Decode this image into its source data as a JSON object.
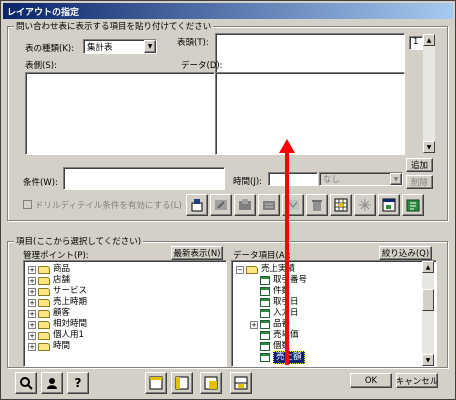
{
  "dialog": {
    "title": "レイアウトの指定"
  },
  "query_group": {
    "label": "問い合わせ表に表示する項目を貼り付けてください",
    "table_type_label": "表の種類(K):",
    "table_type_value": "集計表",
    "header_label": "表頭(T):",
    "side_label": "表側(S):",
    "data_label": "データ(D):",
    "page_number": "1",
    "add_button": "追加",
    "delete_button": "削除",
    "condition_label": "条件(W):",
    "time_label": "時間(J):",
    "time_select_value": "なし",
    "drilldown_checkbox": "ドリルディテイル条件を有効にする(L)"
  },
  "items_group": {
    "label": "項目(ここから選択してください)",
    "management_label": "管理ポイント(P):",
    "refresh_button": "最新表示(N)",
    "data_items_label": "データ項目(A):",
    "filter_button": "絞り込み(Q)",
    "management_tree": [
      "商品",
      "店舗",
      "サービス",
      "売上時期",
      "顧客",
      "相対時間",
      "個人用1",
      "時間"
    ],
    "data_tree_root": "売上実績",
    "data_tree_items": [
      "取引番号",
      "件数",
      "取引日",
      "入力日",
      "品番",
      "売単価",
      "個数",
      "売上額"
    ]
  },
  "footer": {
    "ok": "OK",
    "cancel": "キャンセル"
  },
  "colors": {
    "title_start": "#0a246a",
    "title_end": "#a6caf0",
    "arrow": "#ff0000",
    "selection": "#0a246a"
  }
}
